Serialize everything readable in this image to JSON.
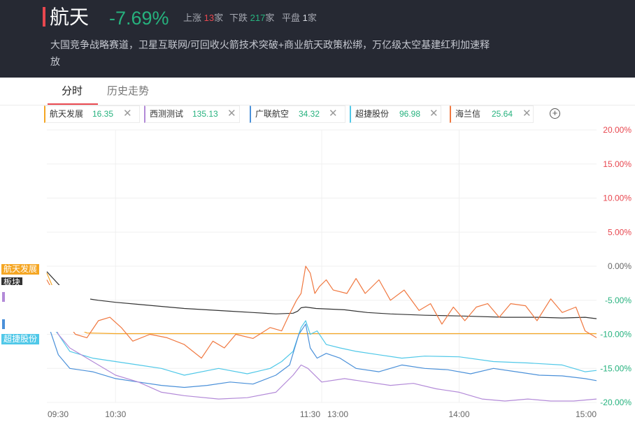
{
  "header": {
    "title": "航天",
    "change": "-7.69%",
    "up_label": "上涨",
    "up_count": "13",
    "up_unit": "家",
    "down_label": "下跌",
    "down_count": "217",
    "down_unit": "家",
    "flat_label": "平盘",
    "flat_count": "1",
    "flat_unit": "家",
    "description": "大国竞争战略赛道，卫星互联网/可回收火箭技术突破+商业航天政策松绑，万亿级太空基建红利加速释放"
  },
  "tabs": [
    "分时",
    "历史走势"
  ],
  "chips": [
    {
      "name": "航天发展",
      "value": "16.35",
      "color": "#f5a623"
    },
    {
      "name": "西测测试",
      "value": "135.13",
      "color": "#b38ad8"
    },
    {
      "name": "广联航空",
      "value": "34.32",
      "color": "#4a90d9"
    },
    {
      "name": "超捷股份",
      "value": "96.98",
      "color": "#50c8e8"
    },
    {
      "name": "海兰信",
      "value": "25.64",
      "color": "#f07840"
    }
  ],
  "add_icon": "plus-circle-icon",
  "close_icon": "close-x-icon",
  "colors": {
    "up": "#e8474f",
    "down": "#26b27e",
    "sector": "#333333"
  },
  "chart_data": {
    "type": "line",
    "x_ticks": [
      "09:30",
      "10:30",
      "11:30",
      "13:00",
      "14:00",
      "15:00"
    ],
    "y_ticks": [
      "20.00%",
      "15.00%",
      "10.00%",
      "5.00%",
      "0.00%",
      "-5.00%",
      "-10.00%",
      "-15.00%",
      "-20.00%"
    ],
    "ylim": [
      -20,
      20
    ],
    "tags": [
      "航天发展",
      "板块",
      "超捷股份"
    ],
    "series": [
      {
        "name": "板块",
        "color": "#333333",
        "points": [
          [
            0,
            -0.8
          ],
          [
            12,
            -3
          ],
          [
            25,
            -4.5
          ],
          [
            45,
            -5
          ],
          [
            60,
            -5.3
          ],
          [
            80,
            -5.6
          ],
          [
            120,
            -6.2
          ],
          [
            160,
            -6.6
          ],
          [
            180,
            -6.8
          ],
          [
            200,
            -7
          ],
          [
            215,
            -6.9
          ],
          [
            219,
            -6.6
          ],
          [
            222,
            -6.1
          ],
          [
            226,
            -6
          ],
          [
            235,
            -6.2
          ],
          [
            260,
            -6.4
          ],
          [
            280,
            -6.8
          ],
          [
            300,
            -7
          ],
          [
            330,
            -7.2
          ],
          [
            360,
            -7.3
          ],
          [
            400,
            -7.5
          ],
          [
            430,
            -7.5
          ],
          [
            450,
            -7.6
          ],
          [
            470,
            -7.5
          ],
          [
            480,
            -7.7
          ]
        ]
      },
      {
        "name": "航天发展",
        "color": "#f5a623",
        "points": [
          [
            0,
            -1
          ],
          [
            10,
            -5
          ],
          [
            18,
            -8
          ],
          [
            25,
            -9
          ],
          [
            35,
            -9.8
          ],
          [
            60,
            -9.9
          ],
          [
            240,
            -9.9
          ],
          [
            480,
            -9.9
          ]
        ]
      },
      {
        "name": "海兰信",
        "color": "#f07840",
        "points": [
          [
            0,
            -2
          ],
          [
            10,
            -5
          ],
          [
            18,
            -8.5
          ],
          [
            25,
            -10
          ],
          [
            35,
            -10.5
          ],
          [
            45,
            -8
          ],
          [
            55,
            -7.5
          ],
          [
            65,
            -9
          ],
          [
            75,
            -11
          ],
          [
            90,
            -10
          ],
          [
            105,
            -10.5
          ],
          [
            120,
            -11.5
          ],
          [
            135,
            -13.5
          ],
          [
            145,
            -11
          ],
          [
            155,
            -12
          ],
          [
            165,
            -10
          ],
          [
            180,
            -10.6
          ],
          [
            195,
            -9
          ],
          [
            205,
            -9.5
          ],
          [
            212,
            -7
          ],
          [
            218,
            -5
          ],
          [
            222,
            -4
          ],
          [
            226,
            0
          ],
          [
            230,
            -1
          ],
          [
            234,
            -4
          ],
          [
            238,
            -3
          ],
          [
            244,
            -2
          ],
          [
            250,
            -3.5
          ],
          [
            262,
            -4
          ],
          [
            270,
            -1.8
          ],
          [
            278,
            -4
          ],
          [
            290,
            -2
          ],
          [
            300,
            -5
          ],
          [
            312,
            -3.5
          ],
          [
            325,
            -6.5
          ],
          [
            335,
            -5.5
          ],
          [
            345,
            -8.5
          ],
          [
            355,
            -6
          ],
          [
            365,
            -8
          ],
          [
            375,
            -6
          ],
          [
            385,
            -5.5
          ],
          [
            395,
            -7.5
          ],
          [
            405,
            -5.5
          ],
          [
            418,
            -5.8
          ],
          [
            428,
            -8
          ],
          [
            440,
            -4.8
          ],
          [
            450,
            -6.8
          ],
          [
            462,
            -6
          ],
          [
            470,
            -9.5
          ],
          [
            480,
            -10.5
          ]
        ]
      },
      {
        "name": "超捷股份",
        "color": "#50c8e8",
        "points": [
          [
            0,
            -8
          ],
          [
            10,
            -10
          ],
          [
            20,
            -12.5
          ],
          [
            40,
            -13.5
          ],
          [
            60,
            -14
          ],
          [
            80,
            -14.5
          ],
          [
            100,
            -15
          ],
          [
            120,
            -16
          ],
          [
            150,
            -15
          ],
          [
            175,
            -15.8
          ],
          [
            195,
            -15
          ],
          [
            205,
            -14
          ],
          [
            215,
            -12.5
          ],
          [
            222,
            -9
          ],
          [
            226,
            -8
          ],
          [
            230,
            -10
          ],
          [
            236,
            -9.5
          ],
          [
            244,
            -11.5
          ],
          [
            256,
            -12
          ],
          [
            270,
            -12.5
          ],
          [
            290,
            -13
          ],
          [
            310,
            -13.5
          ],
          [
            330,
            -13.2
          ],
          [
            360,
            -13.3
          ],
          [
            390,
            -14
          ],
          [
            420,
            -14.2
          ],
          [
            450,
            -14.5
          ],
          [
            470,
            -15.5
          ],
          [
            480,
            -15.3
          ]
        ]
      },
      {
        "name": "广联航空",
        "color": "#4a90d9",
        "points": [
          [
            0,
            -8
          ],
          [
            10,
            -13
          ],
          [
            20,
            -15
          ],
          [
            40,
            -15.5
          ],
          [
            60,
            -16.5
          ],
          [
            80,
            -17
          ],
          [
            100,
            -17.5
          ],
          [
            120,
            -17.8
          ],
          [
            140,
            -17.5
          ],
          [
            160,
            -17
          ],
          [
            180,
            -17.3
          ],
          [
            200,
            -16
          ],
          [
            212,
            -14.5
          ],
          [
            220,
            -10
          ],
          [
            226,
            -8.5
          ],
          [
            230,
            -12
          ],
          [
            236,
            -13.5
          ],
          [
            244,
            -12.8
          ],
          [
            256,
            -13.5
          ],
          [
            270,
            -15
          ],
          [
            290,
            -15.5
          ],
          [
            310,
            -14.5
          ],
          [
            330,
            -15
          ],
          [
            350,
            -15.2
          ],
          [
            370,
            -15.8
          ],
          [
            390,
            -15
          ],
          [
            410,
            -15.5
          ],
          [
            430,
            -16
          ],
          [
            450,
            -16.1
          ],
          [
            470,
            -16.5
          ],
          [
            480,
            -16.8
          ]
        ]
      },
      {
        "name": "西测测试",
        "color": "#b38ad8",
        "points": [
          [
            0,
            -6
          ],
          [
            10,
            -10
          ],
          [
            20,
            -12
          ],
          [
            40,
            -14
          ],
          [
            60,
            -16
          ],
          [
            80,
            -17
          ],
          [
            100,
            -18.5
          ],
          [
            120,
            -19
          ],
          [
            150,
            -19.5
          ],
          [
            175,
            -19.3
          ],
          [
            200,
            -18.5
          ],
          [
            215,
            -16
          ],
          [
            222,
            -14.5
          ],
          [
            228,
            -15
          ],
          [
            240,
            -17
          ],
          [
            260,
            -16.5
          ],
          [
            280,
            -17
          ],
          [
            300,
            -17.5
          ],
          [
            320,
            -17.2
          ],
          [
            340,
            -18
          ],
          [
            360,
            -18.5
          ],
          [
            380,
            -19.5
          ],
          [
            400,
            -19.8
          ],
          [
            420,
            -19.5
          ],
          [
            440,
            -19.8
          ],
          [
            460,
            -19.8
          ],
          [
            480,
            -19.5
          ]
        ]
      }
    ]
  }
}
